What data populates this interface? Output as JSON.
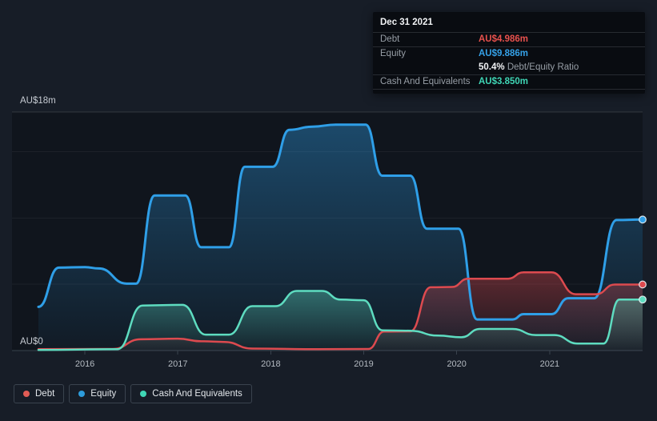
{
  "tooltip": {
    "date": "Dec 31 2021",
    "debt_label": "Debt",
    "debt_value": "AU$4.986m",
    "equity_label": "Equity",
    "equity_value": "AU$9.886m",
    "ratio_value": "50.4%",
    "ratio_label": "Debt/Equity Ratio",
    "cash_label": "Cash And Equivalents",
    "cash_value": "AU$3.850m"
  },
  "legend": {
    "debt": "Debt",
    "equity": "Equity",
    "cash": "Cash And Equivalents"
  },
  "chart_data": {
    "type": "area",
    "x_range": [
      2015.5,
      2022.0
    ],
    "x_ticks": [
      2016,
      2017,
      2018,
      2019,
      2020,
      2021
    ],
    "y_axis": {
      "top_label": "AU$18m",
      "bottom_label": "AU$0",
      "range": [
        0,
        18
      ],
      "gridlines": [
        0,
        5,
        10,
        15,
        18
      ]
    },
    "legend_position": "bottom-left",
    "grid": "horizontal",
    "series": [
      {
        "name": "Equity",
        "color": "#2f9fe8",
        "points": [
          [
            2015.5,
            3.3
          ],
          [
            2015.72,
            6.26
          ],
          [
            2016.0,
            6.3
          ],
          [
            2016.15,
            6.2
          ],
          [
            2016.45,
            5.05
          ],
          [
            2016.55,
            5.05
          ],
          [
            2016.75,
            11.7
          ],
          [
            2017.08,
            11.7
          ],
          [
            2017.25,
            7.8
          ],
          [
            2017.55,
            7.8
          ],
          [
            2017.72,
            13.87
          ],
          [
            2018.02,
            13.87
          ],
          [
            2018.2,
            16.66
          ],
          [
            2018.45,
            16.9
          ],
          [
            2018.7,
            17.05
          ],
          [
            2019.02,
            17.05
          ],
          [
            2019.2,
            13.2
          ],
          [
            2019.5,
            13.2
          ],
          [
            2019.68,
            9.2
          ],
          [
            2020.02,
            9.2
          ],
          [
            2020.22,
            2.35
          ],
          [
            2020.6,
            2.35
          ],
          [
            2020.72,
            2.75
          ],
          [
            2021.02,
            2.75
          ],
          [
            2021.2,
            3.95
          ],
          [
            2021.48,
            3.95
          ],
          [
            2021.72,
            9.85
          ],
          [
            2022.0,
            9.886
          ]
        ]
      },
      {
        "name": "Debt",
        "color": "#dd4a4f",
        "points": [
          [
            2015.5,
            0.1
          ],
          [
            2016.3,
            0.12
          ],
          [
            2016.6,
            0.85
          ],
          [
            2017.0,
            0.9
          ],
          [
            2017.25,
            0.7
          ],
          [
            2017.5,
            0.65
          ],
          [
            2017.8,
            0.15
          ],
          [
            2018.5,
            0.1
          ],
          [
            2019.05,
            0.12
          ],
          [
            2019.22,
            1.43
          ],
          [
            2019.5,
            1.45
          ],
          [
            2019.72,
            4.78
          ],
          [
            2019.95,
            4.8
          ],
          [
            2020.12,
            5.42
          ],
          [
            2020.55,
            5.42
          ],
          [
            2020.72,
            5.9
          ],
          [
            2021.02,
            5.9
          ],
          [
            2021.28,
            4.25
          ],
          [
            2021.5,
            4.25
          ],
          [
            2021.7,
            4.986
          ],
          [
            2022.0,
            4.986
          ]
        ]
      },
      {
        "name": "Cash And Equivalents",
        "color": "#5edcc0",
        "points": [
          [
            2015.5,
            0.05
          ],
          [
            2016.35,
            0.1
          ],
          [
            2016.62,
            3.4
          ],
          [
            2017.05,
            3.45
          ],
          [
            2017.3,
            1.2
          ],
          [
            2017.55,
            1.2
          ],
          [
            2017.8,
            3.35
          ],
          [
            2018.05,
            3.35
          ],
          [
            2018.28,
            4.5
          ],
          [
            2018.55,
            4.5
          ],
          [
            2018.75,
            3.85
          ],
          [
            2019.0,
            3.8
          ],
          [
            2019.2,
            1.53
          ],
          [
            2019.5,
            1.5
          ],
          [
            2019.8,
            1.13
          ],
          [
            2020.05,
            1.0
          ],
          [
            2020.25,
            1.63
          ],
          [
            2020.6,
            1.63
          ],
          [
            2020.85,
            1.17
          ],
          [
            2021.05,
            1.17
          ],
          [
            2021.3,
            0.53
          ],
          [
            2021.58,
            0.53
          ],
          [
            2021.75,
            3.85
          ],
          [
            2022.0,
            3.85
          ]
        ]
      }
    ]
  }
}
